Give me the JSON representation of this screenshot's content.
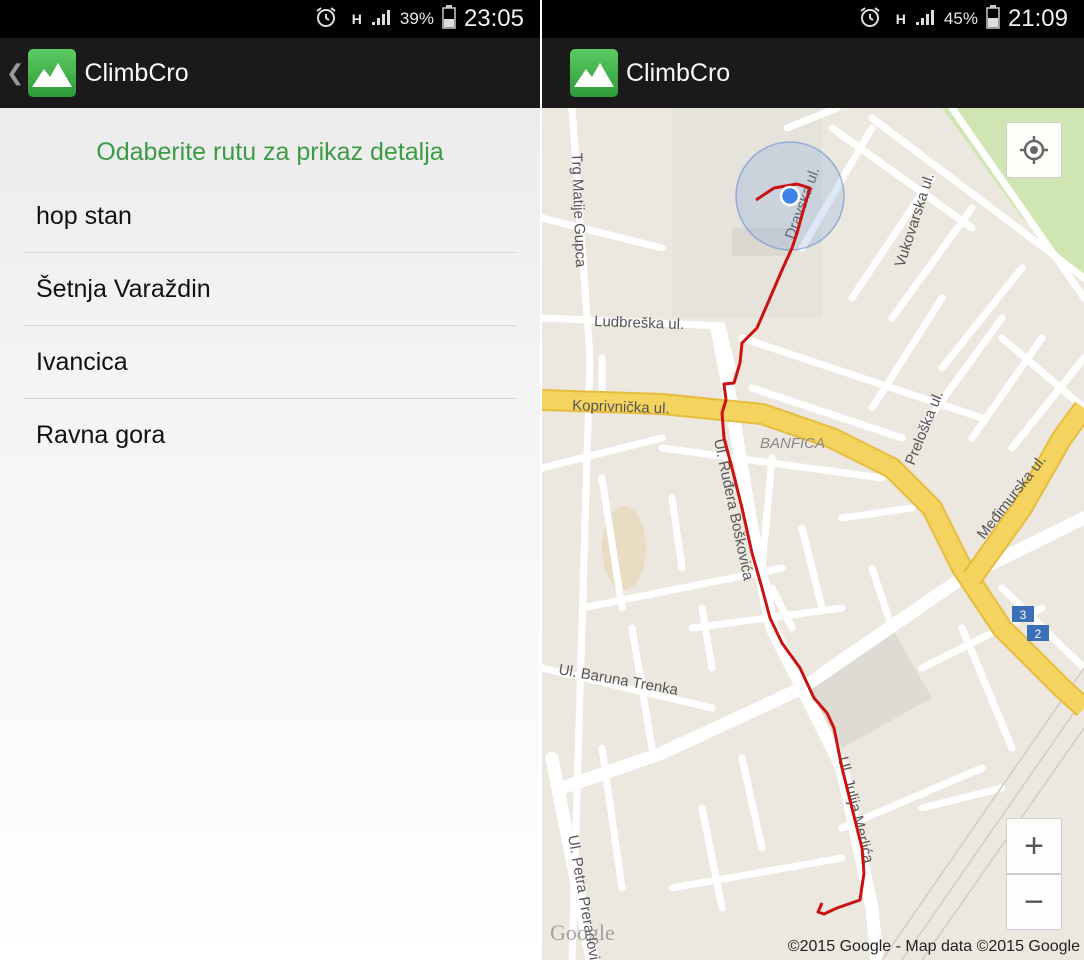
{
  "left_screen": {
    "status": {
      "battery": "39%",
      "time": "23:05",
      "network": "H"
    },
    "app_title": "ClimbCro",
    "list_header": "Odaberite rutu za prikaz detalja",
    "routes": [
      "hop stan",
      "Šetnja Varaždin",
      "Ivancica",
      "Ravna gora"
    ]
  },
  "right_screen": {
    "status": {
      "battery": "45%",
      "time": "21:09",
      "network": "H"
    },
    "app_title": "ClimbCro",
    "map": {
      "streets": {
        "trg": "Trg Matije Gupca",
        "dravska": "Dravska ul.",
        "vukovarska": "Vukovarska ul.",
        "ludbreska": "Ludbreška ul.",
        "koprivnicka": "Koprivnička ul.",
        "banfica": "BANFICA",
        "preloska": "Preloška ul.",
        "medimurska": "Međimurska ul.",
        "boskovica": "Ul. Ruđera Boškovića",
        "baruna": "Ul. Baruna Trenka",
        "julija": "Ul. Julija Merlića",
        "petra": "Ul. Petra Preradovića"
      },
      "road_badges": [
        "3",
        "2"
      ],
      "zoom_in": "+",
      "zoom_out": "−",
      "google_logo": "Google",
      "copyright": "©2015 Google - Map data ©2015 Google",
      "colors": {
        "route": "#cc1111",
        "major_road": "#f4d35e",
        "location": "#3d84e8"
      }
    }
  }
}
